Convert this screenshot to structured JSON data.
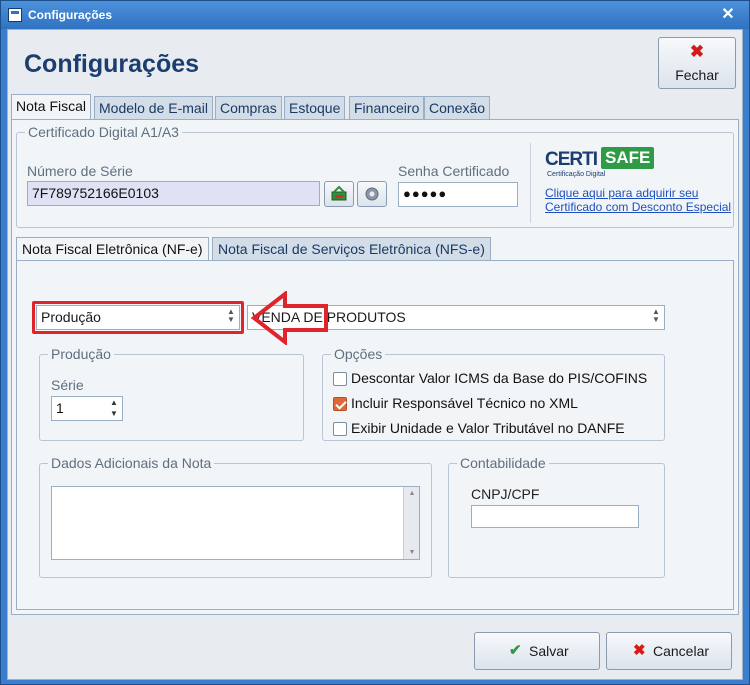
{
  "window": {
    "title": "Configurações"
  },
  "header": {
    "title": "Configurações",
    "close_label": "Fechar"
  },
  "tabs": [
    {
      "label": "Nota Fiscal",
      "active": true
    },
    {
      "label": "Modelo de E-mail"
    },
    {
      "label": "Compras"
    },
    {
      "label": "Estoque"
    },
    {
      "label": "Financeiro"
    },
    {
      "label": "Conexão"
    }
  ],
  "certificado": {
    "group_title": "Certificado Digital A1/A3",
    "serial_label": "Número de Série",
    "serial_value": "7F789752166E0103",
    "password_label": "Senha Certificado",
    "password_value": "●●●●●",
    "logo_text_left": "CERTI",
    "logo_text_right": "SAFE",
    "logo_subtext": "Certificação Digital",
    "link_text": "Clique aqui para adquirir seu Certificado com Desconto Especial"
  },
  "subtabs": [
    {
      "label": "Nota Fiscal Eletrônica (NF-e)",
      "active": true
    },
    {
      "label": "Nota Fiscal de Serviços Eletrônica (NFS-e)"
    }
  ],
  "nfe": {
    "environment_value": "Produção",
    "operation_value": "VENDA DE PRODUTOS",
    "producao_group": "Produção",
    "serie_label": "Série",
    "serie_value": "1",
    "opcoes_group": "Opções",
    "options": [
      {
        "label": "Descontar Valor ICMS da Base do PIS/COFINS",
        "checked": false
      },
      {
        "label": "Incluir Responsável Técnico no XML",
        "checked": true
      },
      {
        "label": "Exibir Unidade e Valor Tributável no DANFE",
        "checked": false
      }
    ],
    "dados_group": "Dados Adicionais da Nota",
    "contabilidade_group": "Contabilidade",
    "cnpj_label": "CNPJ/CPF"
  },
  "footer": {
    "save_label": "Salvar",
    "cancel_label": "Cancelar"
  },
  "colors": {
    "accent": "#3a7fce",
    "highlight": "#e0242b",
    "title": "#1b3d6f"
  }
}
